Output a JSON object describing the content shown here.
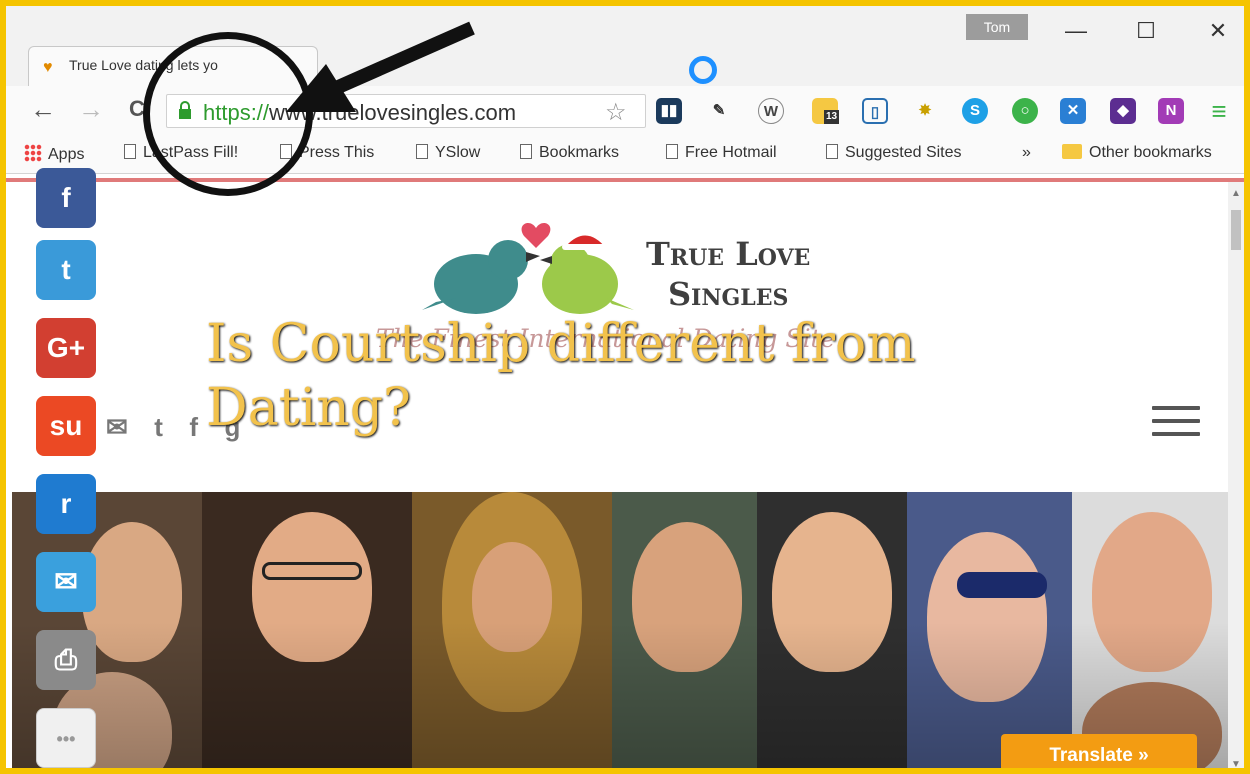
{
  "window": {
    "tab_title": "True Love dating lets yo",
    "profile_name": "Tom",
    "minimize": "—",
    "maximize": "☐",
    "close": "✕"
  },
  "toolbar": {
    "back": "←",
    "forward": "→",
    "reload": "C",
    "url_scheme": "https://",
    "url_rest": "www.truelovesingles.com",
    "star": "☆",
    "menu": "≡"
  },
  "bookmarks": {
    "apps": "Apps",
    "items": [
      "LastPass Fill!",
      "Press This",
      "YSlow",
      "Bookmarks",
      "Free Hotmail",
      "Suggested Sites"
    ],
    "overflow": "»",
    "other": "Other bookmarks"
  },
  "page": {
    "logo_line1": "True Love",
    "logo_line2": "Singles",
    "tagline": "The Finest International Dating Site.",
    "hero_title": "Is Courtship different from Dating?",
    "translate_button": "Translate »",
    "extension_badge": "13"
  },
  "share_bar": [
    {
      "name": "facebook",
      "glyph": "f",
      "color": "#3b5998"
    },
    {
      "name": "twitter",
      "glyph": "t",
      "color": "#3a9ad9"
    },
    {
      "name": "google-plus",
      "glyph": "G+",
      "color": "#d23f31"
    },
    {
      "name": "stumbleupon",
      "glyph": "su",
      "color": "#eb4924"
    },
    {
      "name": "reddit",
      "glyph": "r",
      "color": "#1f7bd0"
    },
    {
      "name": "email",
      "glyph": "✉",
      "color": "#3aa0dd"
    },
    {
      "name": "print",
      "glyph": "⎙",
      "color": "#8a8a8a"
    },
    {
      "name": "more",
      "glyph": "•••",
      "color": "#f0f0f0"
    }
  ],
  "colors": {
    "window_border": "#f5c400",
    "accent_line": "#e07a7a",
    "tagline": "#c79898",
    "hero_title": "#f2c24c",
    "translate": "#f39c12"
  }
}
